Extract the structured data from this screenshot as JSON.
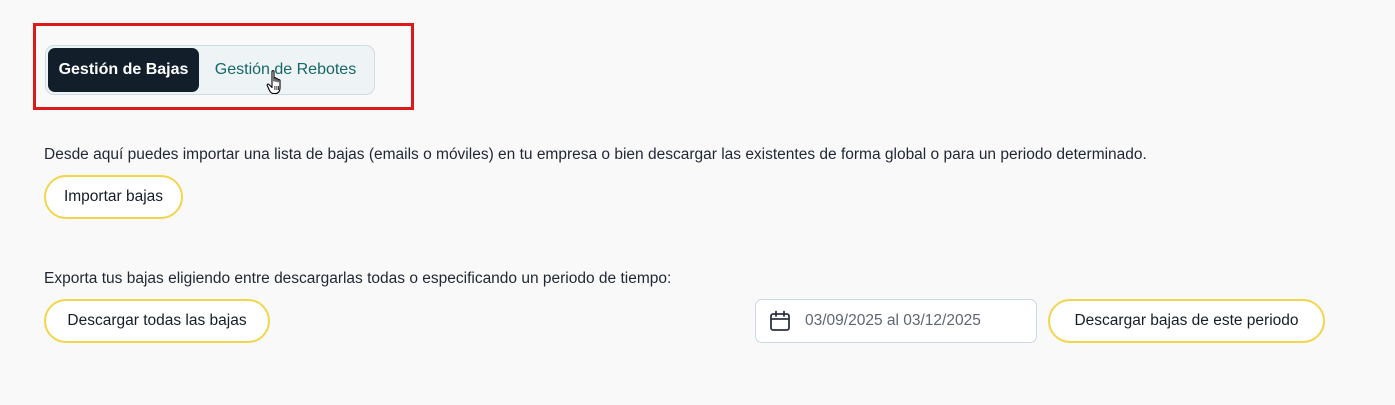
{
  "tabs": [
    {
      "label": "Gestión de Bajas",
      "active": true
    },
    {
      "label": "Gestión de Rebotes",
      "active": false
    }
  ],
  "import_section": {
    "description": "Desde aquí puedes importar una lista de bajas (emails o móviles) en tu empresa o bien descargar las existentes de forma global o para un periodo determinado.",
    "import_button": "Importar bajas"
  },
  "export_section": {
    "description": "Exporta tus bajas eligiendo entre descargarlas todas o especificando un periodo de tiempo:",
    "download_all_button": "Descargar todas las bajas",
    "date_range": "03/09/2025 al 03/12/2025",
    "date_icon": "calendar-icon",
    "download_period_button": "Descargar bajas de este periodo"
  },
  "annotation": {
    "highlight_color": "#dd1a1a"
  },
  "colors": {
    "active_tab_bg": "#121f2b",
    "inactive_tab_text": "#176766",
    "button_border": "#f1d64d",
    "page_bg": "#f9f9fa"
  }
}
